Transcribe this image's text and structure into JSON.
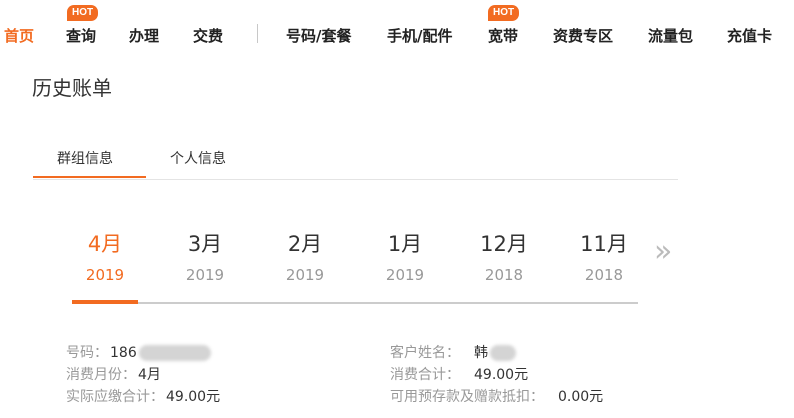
{
  "nav": {
    "items": [
      {
        "label": "首页",
        "active": true
      },
      {
        "label": "查询",
        "hot": true
      },
      {
        "label": "办理"
      },
      {
        "label": "交费"
      },
      {
        "label": "号码/套餐"
      },
      {
        "label": "手机/配件"
      },
      {
        "label": "宽带",
        "hot": true
      },
      {
        "label": "资费专区"
      },
      {
        "label": "流量包"
      },
      {
        "label": "充值卡"
      }
    ],
    "hot_label": "HOT"
  },
  "page_title": "历史账单",
  "tabs": [
    {
      "label": "群组信息",
      "active": true
    },
    {
      "label": "个人信息"
    }
  ],
  "months": [
    {
      "month": "4月",
      "year": "2019",
      "active": true
    },
    {
      "month": "3月",
      "year": "2019"
    },
    {
      "month": "2月",
      "year": "2019"
    },
    {
      "month": "1月",
      "year": "2019"
    },
    {
      "month": "12月",
      "year": "2018"
    },
    {
      "month": "11月",
      "year": "2018"
    }
  ],
  "next_icon": "»",
  "info": {
    "number_label": "号码：",
    "number_value": "186",
    "name_label": "客户姓名：",
    "name_value": "韩",
    "month_label": "消费月份：",
    "month_value": "4月",
    "total_label": "消费合计：",
    "total_value": "49.00元",
    "payable_label": "实际应缴合计：",
    "payable_value": "49.00元",
    "deduct_label": "可用预存款及赠款抵扣：",
    "deduct_value": "0.00元"
  },
  "colors": {
    "accent": "#f26b21"
  }
}
